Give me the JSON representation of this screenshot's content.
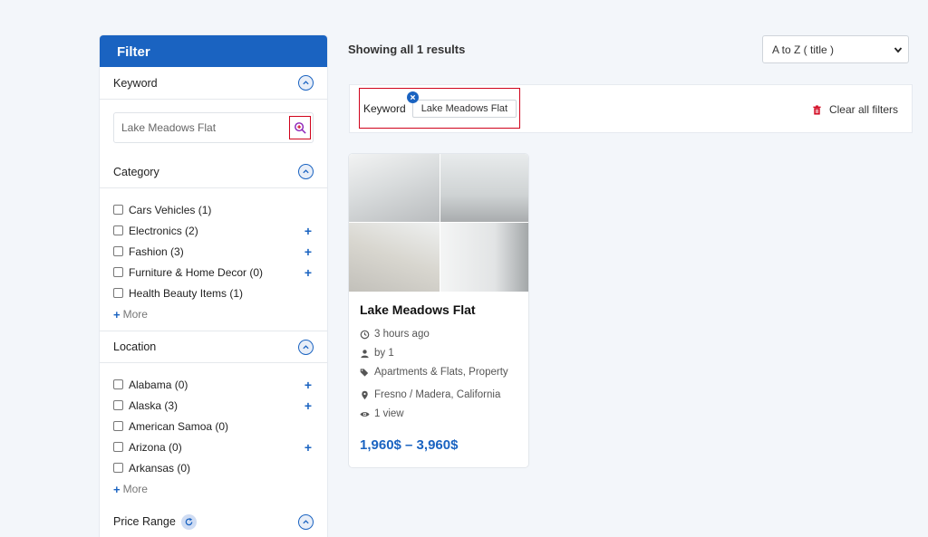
{
  "sidebar": {
    "title": "Filter",
    "keyword": {
      "label": "Keyword",
      "value": "Lake Meadows Flat"
    },
    "category": {
      "label": "Category",
      "items": [
        {
          "label": "Cars Vehicles (1)",
          "expandable": false
        },
        {
          "label": "Electronics (2)",
          "expandable": true
        },
        {
          "label": "Fashion (3)",
          "expandable": true
        },
        {
          "label": "Furniture & Home Decor (0)",
          "expandable": true
        },
        {
          "label": "Health Beauty Items (1)",
          "expandable": false
        }
      ],
      "more": "More"
    },
    "location": {
      "label": "Location",
      "items": [
        {
          "label": "Alabama (0)",
          "expandable": true
        },
        {
          "label": "Alaska (3)",
          "expandable": true
        },
        {
          "label": "American Samoa (0)",
          "expandable": false
        },
        {
          "label": "Arizona (0)",
          "expandable": true
        },
        {
          "label": "Arkansas (0)",
          "expandable": false
        }
      ],
      "more": "More"
    },
    "price_range": {
      "label": "Price Range"
    }
  },
  "main": {
    "results_text": "Showing all 1 results",
    "sort": {
      "selected": "A to Z ( title )"
    },
    "active_filters": {
      "label": "Keyword",
      "chip": "Lake Meadows Flat",
      "clear_all": "Clear all filters"
    },
    "listing": {
      "title": "Lake Meadows Flat",
      "time": "3 hours ago",
      "author": "by 1",
      "categories": "Apartments & Flats, Property",
      "location": "Fresno / Madera, California",
      "views": "1 view",
      "price": "1,960$ – 3,960$"
    }
  },
  "colors": {
    "accent": "#1a63c1",
    "highlight_border": "#d0021b",
    "trash": "#d0021b"
  }
}
